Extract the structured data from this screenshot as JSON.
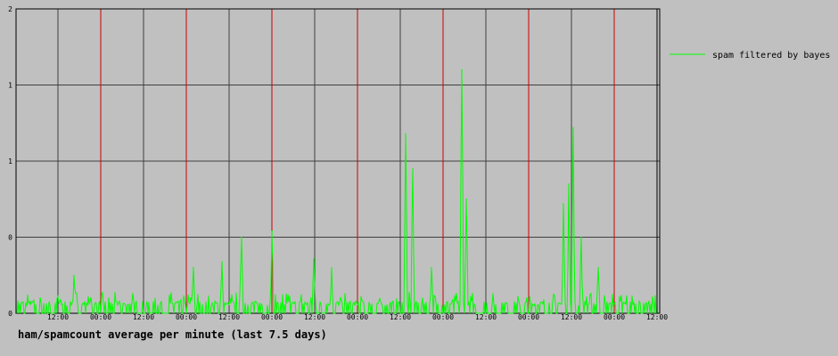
{
  "caption": "ham/spamcount average per minute (last 7.5 days)",
  "chart_data": {
    "type": "line",
    "title": "ham/spamcount average per minute (last 7.5 days)",
    "xlabel": "",
    "ylabel": "",
    "x_tick_labels": [
      "12:00",
      "00:00",
      "12:00",
      "00:00",
      "12:00",
      "00:00",
      "12:00",
      "00:00",
      "12:00",
      "00:00",
      "12:00",
      "00:00",
      "12:00",
      "00:00",
      "12:00"
    ],
    "y_tick_labels": [
      "0",
      "0",
      "1",
      "1",
      "2"
    ],
    "ylim": [
      0,
      2
    ],
    "grid": true,
    "legend": "right",
    "colors": {
      "background": "#c0c0c0",
      "plot_background": "#c0c0c0",
      "grid_hour": "#404040",
      "grid_midnight": "#cc0000",
      "series": "#00ff00",
      "text": "#000000"
    },
    "series": [
      {
        "name": "spam filtered by bayes",
        "color": "#00ff00",
        "peaks": [
          {
            "x": 0.018,
            "y": 0.12
          },
          {
            "x": 0.09,
            "y": 0.25
          },
          {
            "x": 0.275,
            "y": 0.3
          },
          {
            "x": 0.32,
            "y": 0.34
          },
          {
            "x": 0.35,
            "y": 0.5
          },
          {
            "x": 0.398,
            "y": 0.54
          },
          {
            "x": 0.463,
            "y": 0.36
          },
          {
            "x": 0.49,
            "y": 0.3
          },
          {
            "x": 0.605,
            "y": 1.18
          },
          {
            "x": 0.617,
            "y": 0.95
          },
          {
            "x": 0.645,
            "y": 0.3
          },
          {
            "x": 0.693,
            "y": 1.6
          },
          {
            "x": 0.7,
            "y": 0.75
          },
          {
            "x": 0.85,
            "y": 0.72
          },
          {
            "x": 0.859,
            "y": 0.85
          },
          {
            "x": 0.866,
            "y": 1.22
          },
          {
            "x": 0.878,
            "y": 0.5
          },
          {
            "x": 0.905,
            "y": 0.3
          }
        ]
      }
    ]
  }
}
